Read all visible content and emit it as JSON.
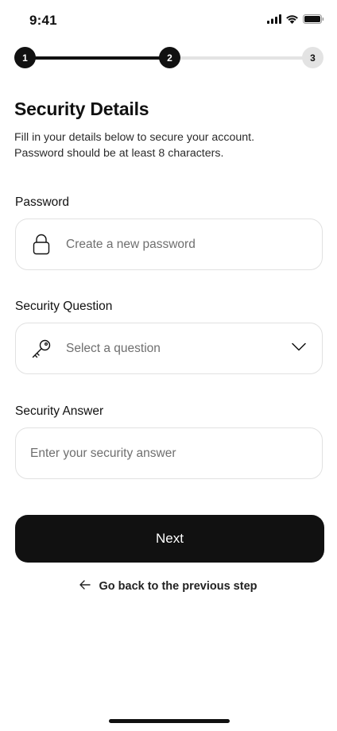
{
  "status_bar": {
    "time": "9:41",
    "icons": [
      "signal-icon",
      "wifi-icon",
      "battery-icon"
    ]
  },
  "stepper": {
    "steps": [
      {
        "label": "1",
        "state": "active"
      },
      {
        "label": "2",
        "state": "active"
      },
      {
        "label": "3",
        "state": "pending"
      }
    ],
    "progress_fraction": 0.5
  },
  "header": {
    "title": "Security Details",
    "subtitle_lines": [
      "Fill in your details below to secure your account.",
      "Password should be at least 8 characters."
    ]
  },
  "form": {
    "password": {
      "label": "Password",
      "placeholder": "Create a new password",
      "icon": "lock-icon"
    },
    "security_question": {
      "label": "Security Question",
      "placeholder": "Select a question",
      "icon": "key-icon"
    },
    "security_answer": {
      "label": "Security Answer",
      "placeholder": "Enter your security answer"
    }
  },
  "actions": {
    "next_label": "Next",
    "back_label": "Go back to the previous step"
  },
  "colors": {
    "primary": "#111111",
    "border": "#e1e1e1",
    "placeholder": "#6f6f6f",
    "inactive_step": "#e3e3e3"
  }
}
